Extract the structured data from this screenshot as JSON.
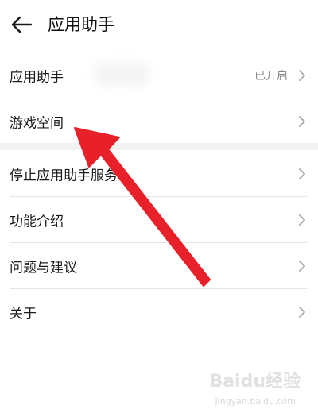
{
  "header": {
    "title": "应用助手",
    "back_icon": "back-arrow-icon"
  },
  "settings": {
    "items": [
      {
        "label": "应用助手",
        "value": "已开启"
      },
      {
        "label": "游戏空间",
        "value": ""
      },
      {
        "label": "停止应用助手服务",
        "value": ""
      },
      {
        "label": "功能介绍",
        "value": ""
      },
      {
        "label": "问题与建议",
        "value": ""
      },
      {
        "label": "关于",
        "value": ""
      }
    ]
  },
  "annotation": {
    "arrow_color": "#e8202a"
  },
  "watermark": {
    "brand": "Baidu经验",
    "url": "jingyan.baidu.com"
  },
  "colors": {
    "text_primary": "#1a1a1a",
    "text_secondary": "#8a8a8a",
    "divider": "#e6e6e6",
    "section_gap": "#f2f2f2"
  }
}
